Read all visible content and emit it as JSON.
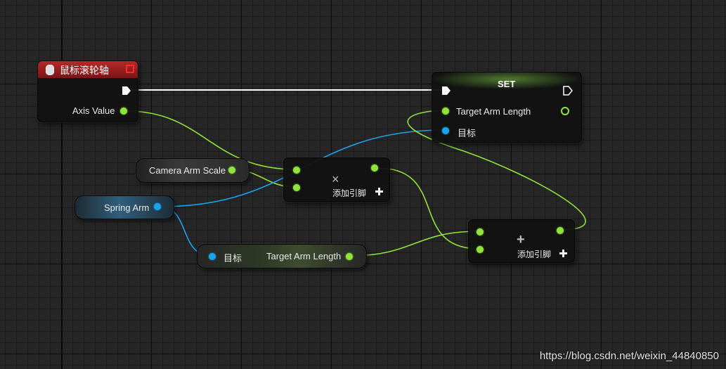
{
  "event_node": {
    "title": "鼠标滚轮轴",
    "output_label": "Axis Value"
  },
  "set_node": {
    "title": "SET",
    "input_label": "Target Arm Length",
    "target_label": "目标"
  },
  "camera_arm_scale": {
    "label": "Camera Arm Scale"
  },
  "spring_arm": {
    "label": "Spring Arm"
  },
  "get_node": {
    "target_label": "目标",
    "output_label": "Target Arm Length"
  },
  "multiply_node": {
    "operator": "×",
    "add_pin_label": "添加引脚"
  },
  "add_node": {
    "operator": "+",
    "add_pin_label": "添加引脚"
  },
  "watermark": "https://blog.csdn.net/weixin_44840850",
  "colors": {
    "float_pin": "#8fe33a",
    "object_pin": "#1aa3f0",
    "event_header": "#8a1b1b",
    "exec_wire": "#ffffff"
  }
}
